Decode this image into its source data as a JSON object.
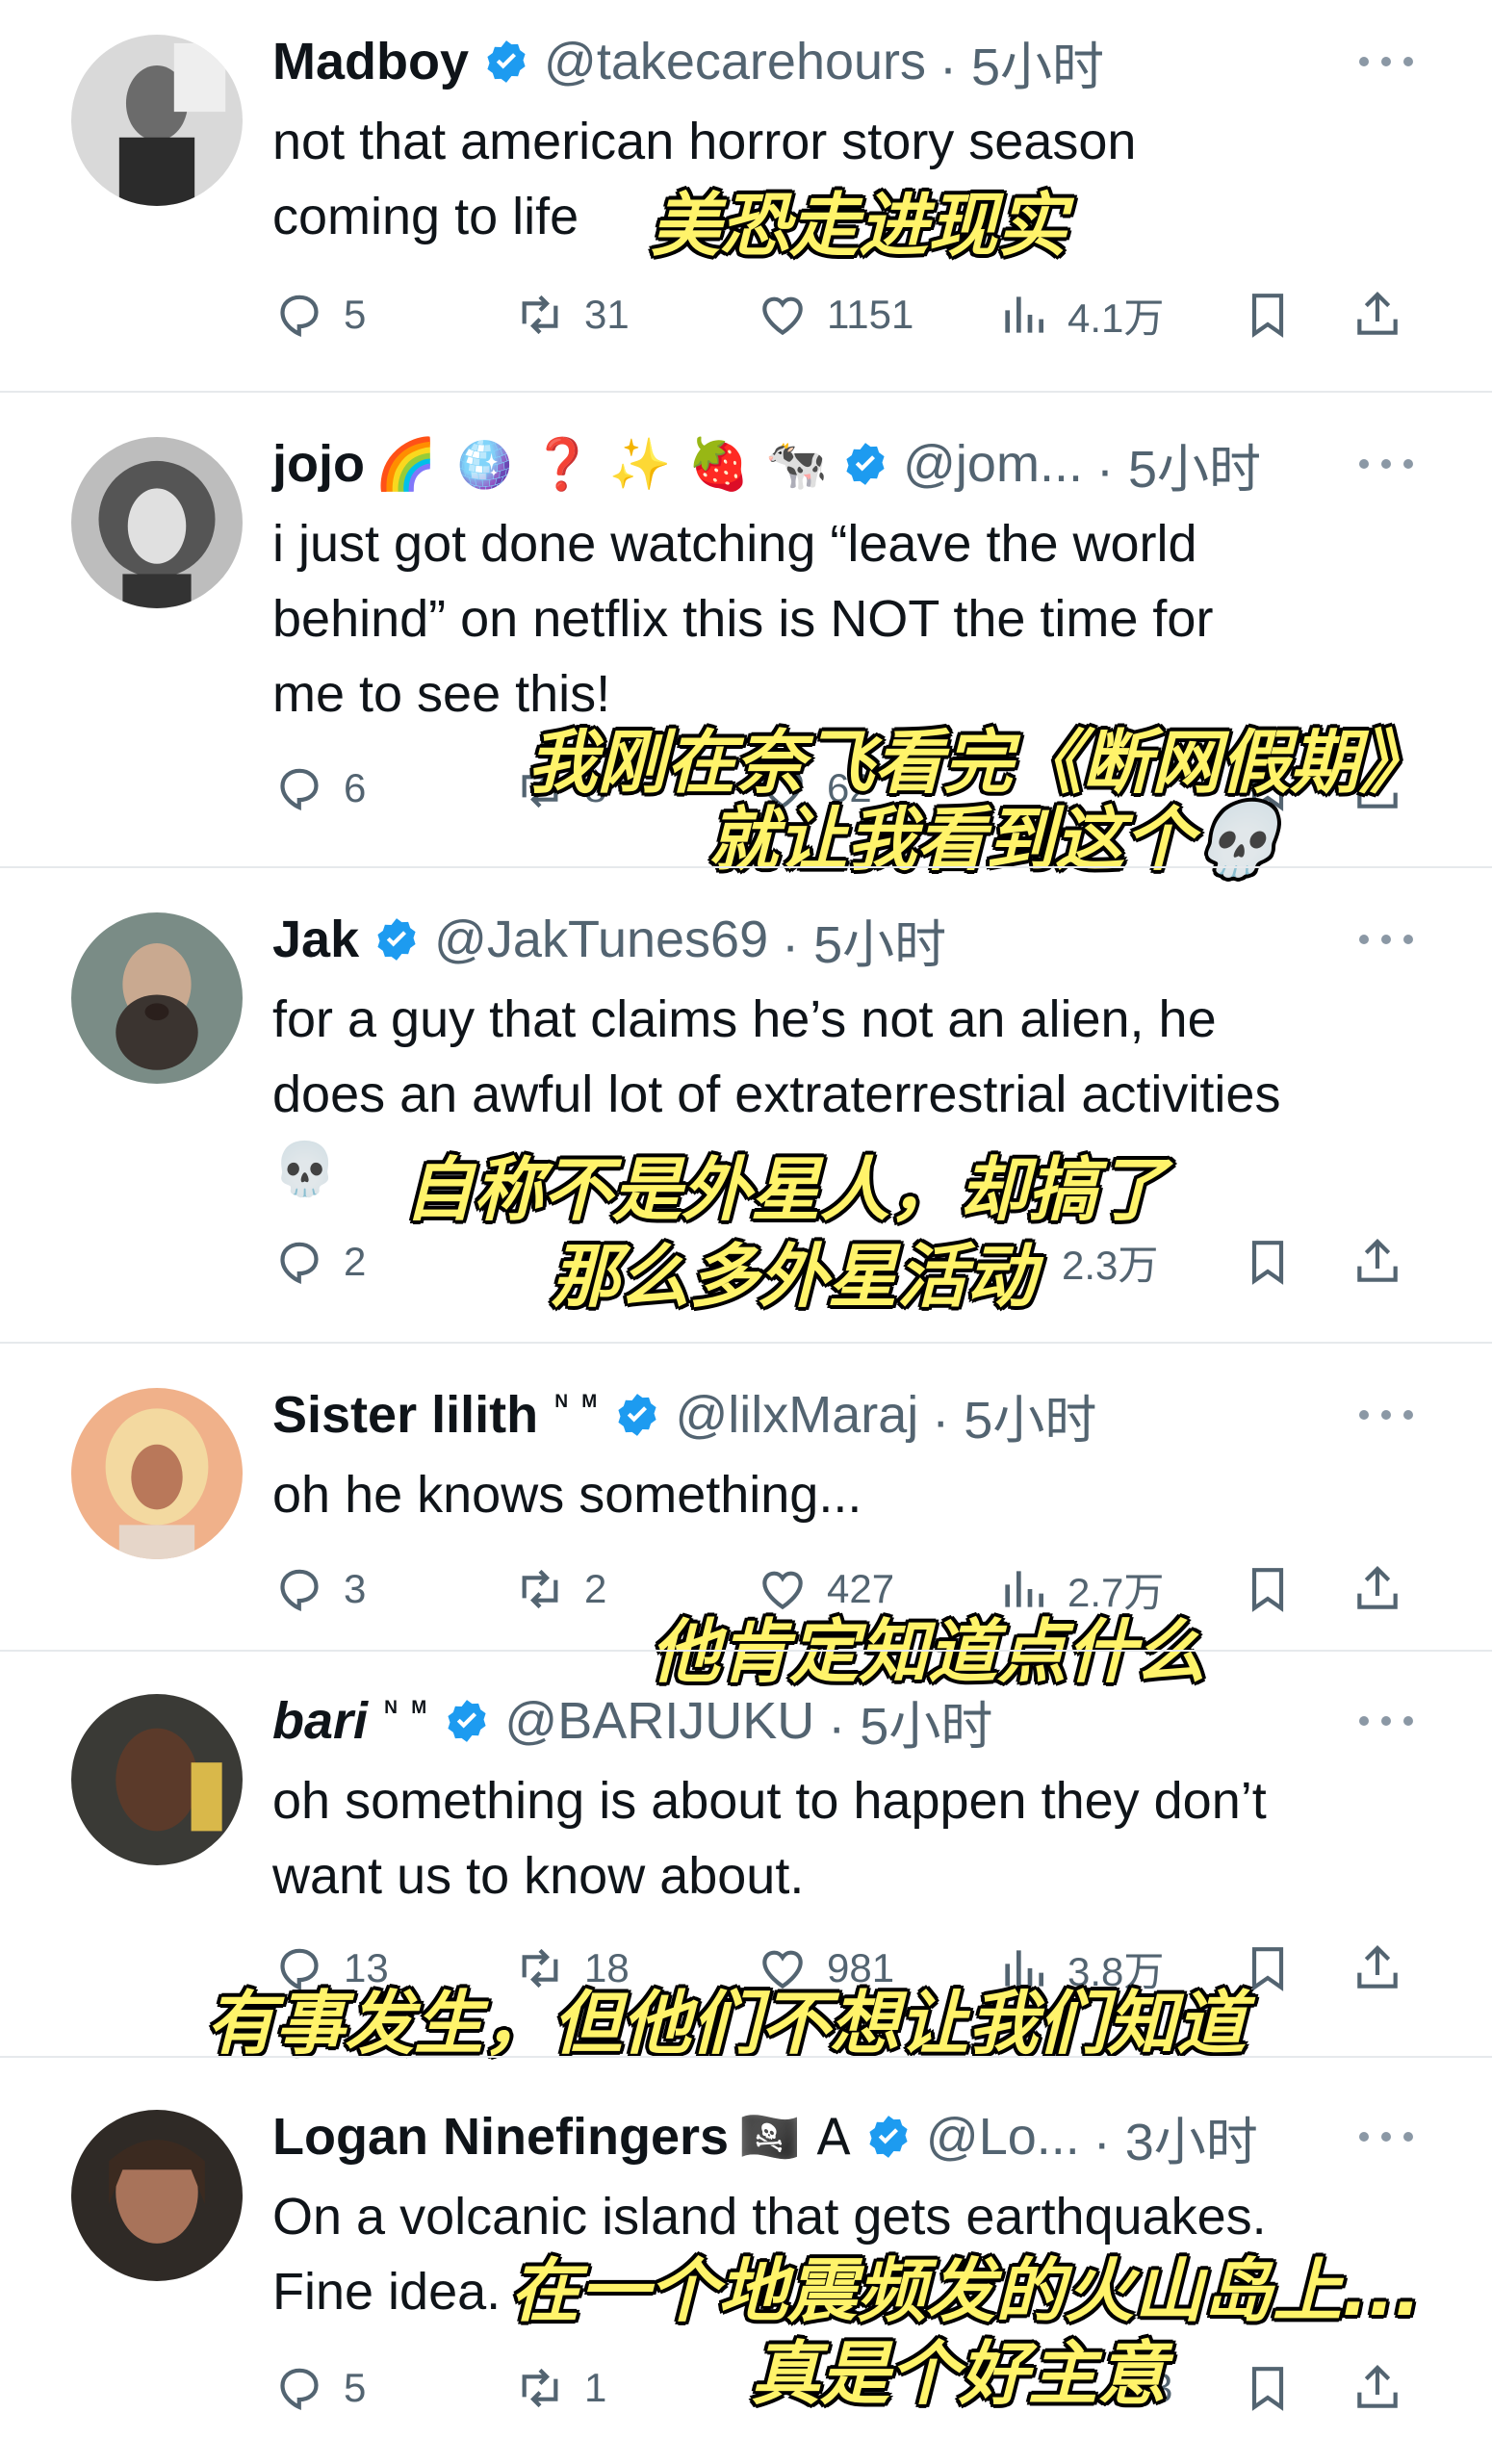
{
  "colors": {
    "verified": "#1d9bf0",
    "muted": "#536471",
    "caption": "#fff36a"
  },
  "tweets": [
    {
      "name": "Madboy",
      "badge": "",
      "emoji": "",
      "handle": "@takecarehours",
      "time": "· 5小时",
      "lines": [
        "not that american horror story season",
        "coming to life"
      ],
      "replies": "5",
      "reposts": "31",
      "likes": "1151",
      "views": "4.1万",
      "caption": [
        "美恐走进现实"
      ]
    },
    {
      "name": "jojo",
      "badge": "",
      "emoji": "🌈 🪩 ❓ ✨ 🍓 🐄",
      "handle": "@jom...",
      "time": "· 5小时",
      "lines": [
        "i just got done watching “leave the world",
        "behind” on netflix this is NOT the time for",
        "me to see this!"
      ],
      "replies": "6",
      "reposts": "8",
      "likes": "62",
      "views": "",
      "caption": [
        "我刚在奈飞看完《断网假期》",
        "就让我看到这个💀"
      ]
    },
    {
      "name": "Jak",
      "badge": "",
      "emoji": "",
      "handle": "@JakTunes69",
      "time": "· 5小时",
      "lines": [
        "for a guy that claims he’s not an alien, he",
        "does an awful lot of extraterrestrial activities",
        "💀"
      ],
      "replies": "2",
      "reposts": "",
      "likes": "",
      "views": "2.3万",
      "caption": [
        "自称不是外星人，却搞了",
        "那么多外星活动"
      ]
    },
    {
      "name": "Sister lilith",
      "badge": "ᴺ ᴹ",
      "emoji": "",
      "handle": "@lilxMaraj",
      "time": "· 5小时",
      "lines": [
        "oh he knows something..."
      ],
      "replies": "3",
      "reposts": "2",
      "likes": "427",
      "views": "2.7万",
      "caption": [
        "他肯定知道点什么"
      ]
    },
    {
      "name": "bari",
      "badge": "ᴺ ᴹ",
      "emoji": "",
      "handle": "@BARIJUKU",
      "time": "· 5小时",
      "lines": [
        "oh something is about to happen they don’t",
        "want us to know about."
      ],
      "replies": "13",
      "reposts": "18",
      "likes": "981",
      "views": "3.8万",
      "caption": [
        "有事发生，但他们不想让我们知道"
      ]
    },
    {
      "name": "Logan Ninefingers",
      "badge": "",
      "emoji": "🏴‍☠️ A",
      "handle": "@Lo...",
      "time": "· 3小时",
      "lines": [
        "On a volcanic island that gets earthquakes.",
        "Fine idea."
      ],
      "replies": "5",
      "reposts": "1",
      "likes": "",
      "views": "3",
      "caption": [
        "在一个地震频发的火山岛上...",
        "真是个好主意"
      ]
    }
  ]
}
